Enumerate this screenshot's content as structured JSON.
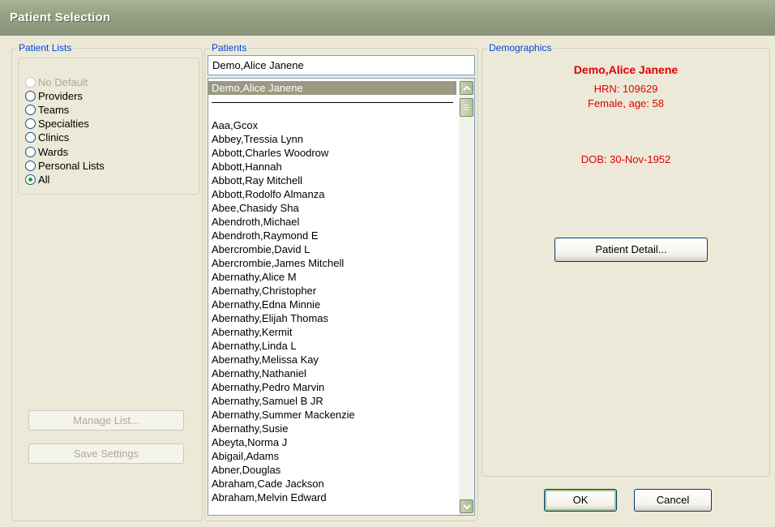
{
  "window": {
    "title": "Patient Selection"
  },
  "patient_lists": {
    "legend": "Patient Lists",
    "options": [
      {
        "label": "No Default",
        "disabled": true,
        "checked": false
      },
      {
        "label": "Providers",
        "disabled": false,
        "checked": false
      },
      {
        "label": "Teams",
        "disabled": false,
        "checked": false
      },
      {
        "label": "Specialties",
        "disabled": false,
        "checked": false
      },
      {
        "label": "Clinics",
        "disabled": false,
        "checked": false
      },
      {
        "label": "Wards",
        "disabled": false,
        "checked": false
      },
      {
        "label": "Personal Lists",
        "disabled": false,
        "checked": false
      },
      {
        "label": "All",
        "disabled": false,
        "checked": true
      }
    ],
    "manage_list_label": "Manage List...",
    "save_settings_label": "Save Settings"
  },
  "patients": {
    "legend": "Patients",
    "search_value": "Demo,Alice Janene",
    "selected": "Demo,Alice Janene",
    "items": [
      "Aaa,Gcox",
      "Abbey,Tressia Lynn",
      "Abbott,Charles Woodrow",
      "Abbott,Hannah",
      "Abbott,Ray Mitchell",
      "Abbott,Rodolfo Almanza",
      "Abee,Chasidy Sha",
      "Abendroth,Michael",
      "Abendroth,Raymond E",
      "Abercrombie,David L",
      "Abercrombie,James Mitchell",
      "Abernathy,Alice M",
      "Abernathy,Christopher",
      "Abernathy,Edna Minnie",
      "Abernathy,Elijah Thomas",
      "Abernathy,Kermit",
      "Abernathy,Linda L",
      "Abernathy,Melissa Kay",
      "Abernathy,Nathaniel",
      "Abernathy,Pedro Marvin",
      "Abernathy,Samuel B JR",
      "Abernathy,Summer Mackenzie",
      "Abernathy,Susie",
      "Abeyta,Norma J",
      "Abigail,Adams",
      "Abner,Douglas",
      "Abraham,Cade Jackson",
      "Abraham,Melvin Edward"
    ]
  },
  "demographics": {
    "legend": "Demographics",
    "name": "Demo,Alice Janene",
    "hrn": "HRN: 109629",
    "sex_age": "Female, age: 58",
    "dob": "DOB: 30-Nov-1952",
    "detail_button": "Patient Detail..."
  },
  "footer": {
    "ok_label": "OK",
    "cancel_label": "Cancel"
  },
  "colors": {
    "legend": "#0046d5",
    "demographics_text": "#e00000",
    "selected_row": "#9a9a82",
    "titlebar": "#95a083"
  }
}
